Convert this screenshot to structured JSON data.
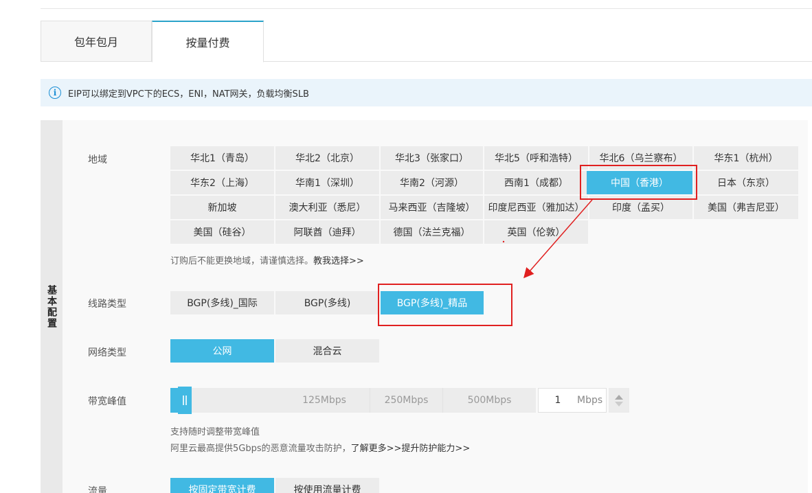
{
  "tabs": [
    {
      "label": "包年包月",
      "active": false
    },
    {
      "label": "按量付费",
      "active": true
    }
  ],
  "notice": {
    "text": "EIP可以绑定到VPC下的ECS，ENI，NAT网关，负载均衡SLB"
  },
  "side_label": "基本配置",
  "region": {
    "label": "地域",
    "options": [
      "华北1（青岛）",
      "华北2（北京）",
      "华北3（张家口）",
      "华北5（呼和浩特）",
      "华北6（乌兰察布）",
      "华东1（杭州）",
      "华东2（上海）",
      "华南1（深圳）",
      "华南2（河源）",
      "西南1（成都）",
      "中国（香港）",
      "日本（东京）",
      "新加坡",
      "澳大利亚（悉尼）",
      "马来西亚（吉隆坡）",
      "印度尼西亚（雅加达）",
      "印度（孟买）",
      "美国（弗吉尼亚）",
      "美国（硅谷）",
      "阿联酋（迪拜）",
      "德国（法兰克福）",
      "英国（伦敦）"
    ],
    "selected": "中国（香港）",
    "hint_text": "订购后不能更换地域，请谨慎选择。",
    "hint_link": "教我选择>>"
  },
  "line_type": {
    "label": "线路类型",
    "options": [
      "BGP(多线)_国际",
      "BGP(多线)",
      "BGP(多线)_精品"
    ],
    "selected": "BGP(多线)_精品"
  },
  "network_type": {
    "label": "网络类型",
    "options": [
      "公网",
      "混合云"
    ],
    "selected": "公网"
  },
  "bandwidth": {
    "label": "带宽峰值",
    "marks": [
      "125Mbps",
      "250Mbps",
      "500Mbps"
    ],
    "value": "1",
    "unit": "Mbps",
    "hint1": "支持随时调整带宽峰值",
    "hint2_text": "阿里云最高提供5Gbps的恶意流量攻击防护，",
    "hint2_link1": "了解更多>>",
    "hint2_link2": "提升防护能力>>"
  },
  "traffic": {
    "label": "流量",
    "options": [
      "按固定带宽计费",
      "按使用流量计费"
    ],
    "selected": "按固定带宽计费"
  },
  "colors": {
    "accent": "#41b9e3",
    "annotation": "#e02020"
  }
}
